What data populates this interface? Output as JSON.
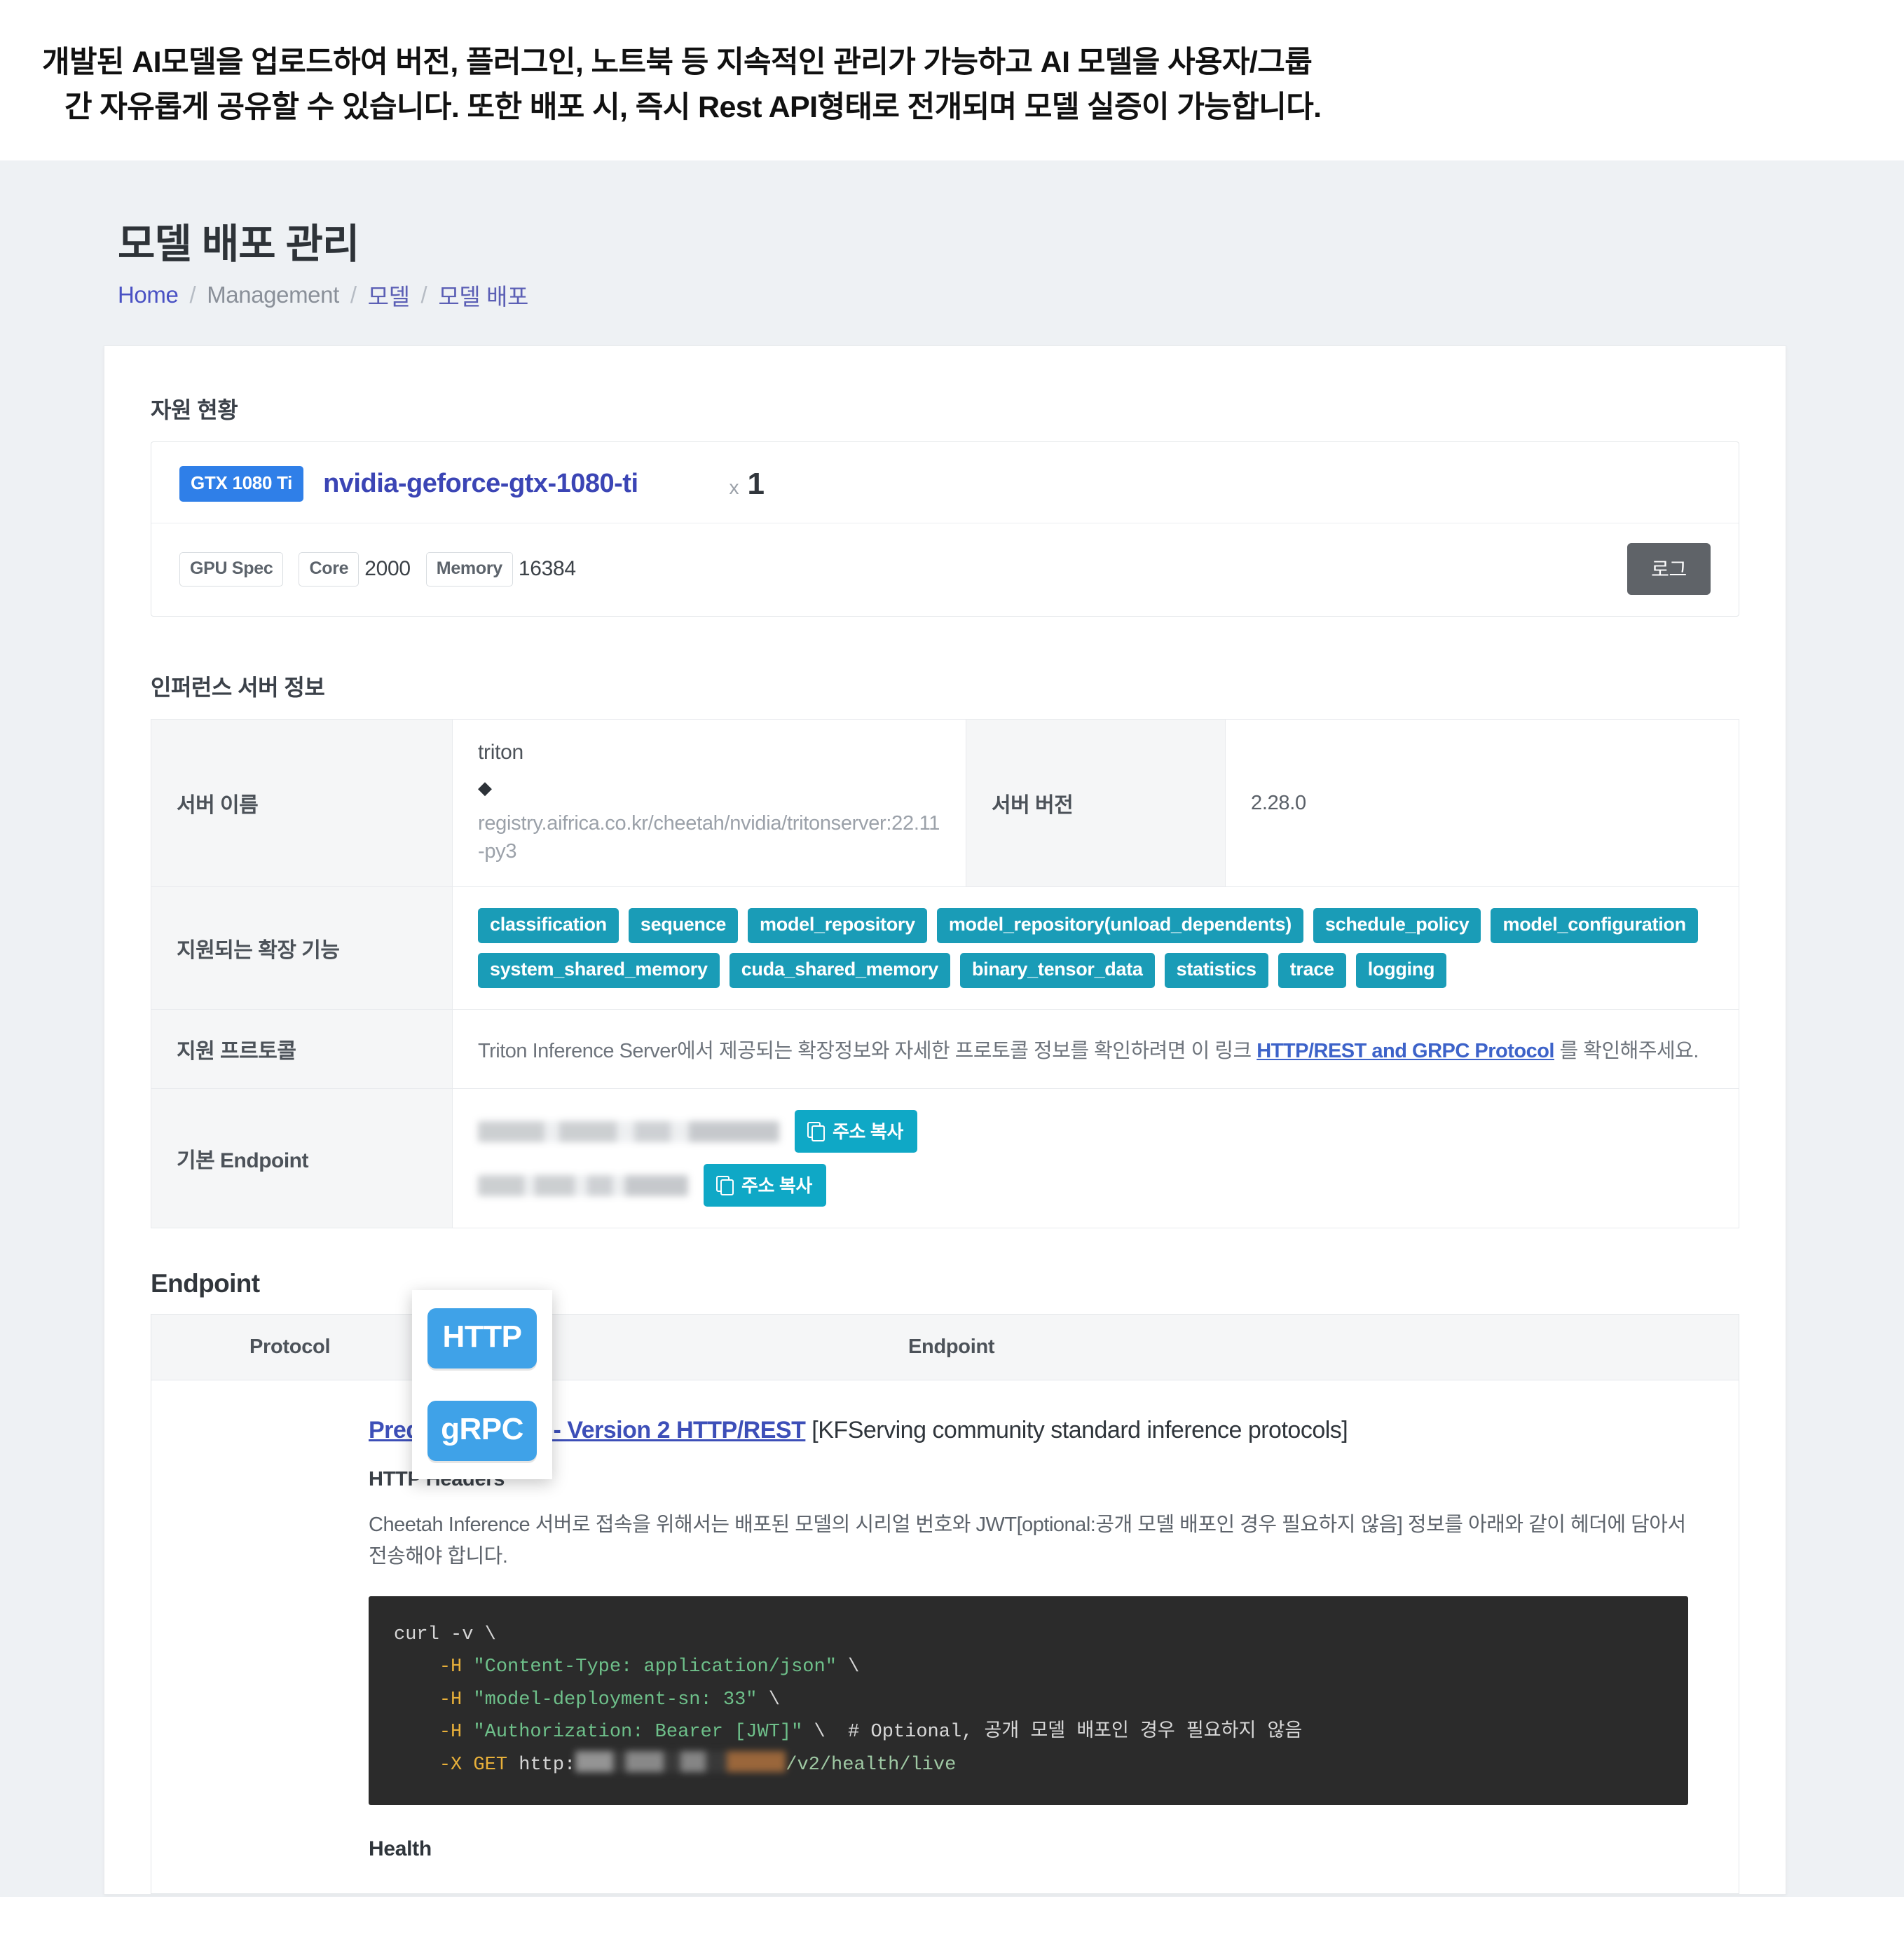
{
  "caption": {
    "line1": "개발된 AI모델을 업로드하여 버전, 플러그인, 노트북 등 지속적인 관리가 가능하고 AI 모델을 사용자/그룹",
    "line2": "간 자유롭게 공유할 수 있습니다. 또한 배포 시, 즉시 Rest API형태로 전개되며 모델 실증이 가능합니다."
  },
  "page": {
    "title": "모델 배포 관리",
    "breadcrumb": {
      "home": "Home",
      "management": "Management",
      "model": "모델",
      "deploy": "모델 배포",
      "separator": "/"
    }
  },
  "resource": {
    "section_title": "자원 현황",
    "gpu_badge": "GTX 1080 Ti",
    "gpu_name": "nvidia-geforce-gtx-1080-ti",
    "multiply_symbol": "x",
    "count": "1",
    "spec_label": "GPU Spec",
    "core_label": "Core",
    "core_value": "2000",
    "memory_label": "Memory",
    "memory_value": "16384",
    "log_button": "로그"
  },
  "server": {
    "section_title": "인퍼런스 서버 정보",
    "rows": {
      "name_label": "서버 이름",
      "name_value": "triton",
      "name_icon": "layers-icon",
      "image": "registry.aifrica.co.kr/cheetah/nvidia/tritonserver:22.11-py3",
      "version_label": "서버 버전",
      "version_value": "2.28.0",
      "extensions_label": "지원되는 확장 기능",
      "protocol_label": "지원 프르토콜",
      "protocol_text_before": "Triton Inference Server에서 제공되는 확장정보와 자세한 프로토콜 정보를 확인하려면 이 링크 ",
      "protocol_link": "HTTP/REST and GRPC Protocol",
      "protocol_text_after": " 를 확인해주세요.",
      "endpoint_label": "기본 Endpoint",
      "copy_button": "주소 복사"
    },
    "extensions": [
      "classification",
      "sequence",
      "model_repository",
      "model_repository(unload_dependents)",
      "schedule_policy",
      "model_configuration",
      "system_shared_memory",
      "cuda_shared_memory",
      "binary_tensor_data",
      "statistics",
      "trace",
      "logging"
    ]
  },
  "protocol_overlay": {
    "http": "HTTP",
    "grpc": "gRPC"
  },
  "endpoint": {
    "heading": "Endpoint",
    "columns": {
      "protocol": "Protocol",
      "endpoint": "Endpoint"
    },
    "predict_link": "Predict Protocol - Version 2 HTTP/REST",
    "predict_suffix": " [KFServing community standard inference protocols]",
    "http_headers_heading": "HTTP Headers",
    "description": "Cheetah Inference 서버로 접속을 위해서는 배포된 모델의 시리얼 번호와 JWT[optional:공개 모델 배포인 경우 필요하지 않음] 정보를 아래와 같이 헤더에 담아서 전송해야 합니다.",
    "code": {
      "line1": "curl -v \\",
      "line2_flag": "-H",
      "line2_str": "\"Content-Type: application/json\"",
      "line2_cont": "\\",
      "line3_flag": "-H",
      "line3_str": "\"model-deployment-sn: 33\"",
      "line3_cont": "\\",
      "line4_flag": "-H",
      "line4_str": "\"Authorization: Bearer [JWT]\"",
      "line4_cont": "\\",
      "line4_comment": "# Optional, 공개 모델 배포인 경우 필요하지 않음",
      "line5_flag": "-X",
      "line5_method": "GET",
      "line5_scheme": "http:",
      "line5_path": "/v2/health/live"
    },
    "health_heading": "Health"
  },
  "colors": {
    "accent_blue": "#3b45b5",
    "badge_blue": "#2f7fe8",
    "tag_teal": "#1a9cb7",
    "copy_teal": "#0fa8c6",
    "overlay_blue": "#3fa2e8",
    "page_bg": "#eef1f4"
  }
}
